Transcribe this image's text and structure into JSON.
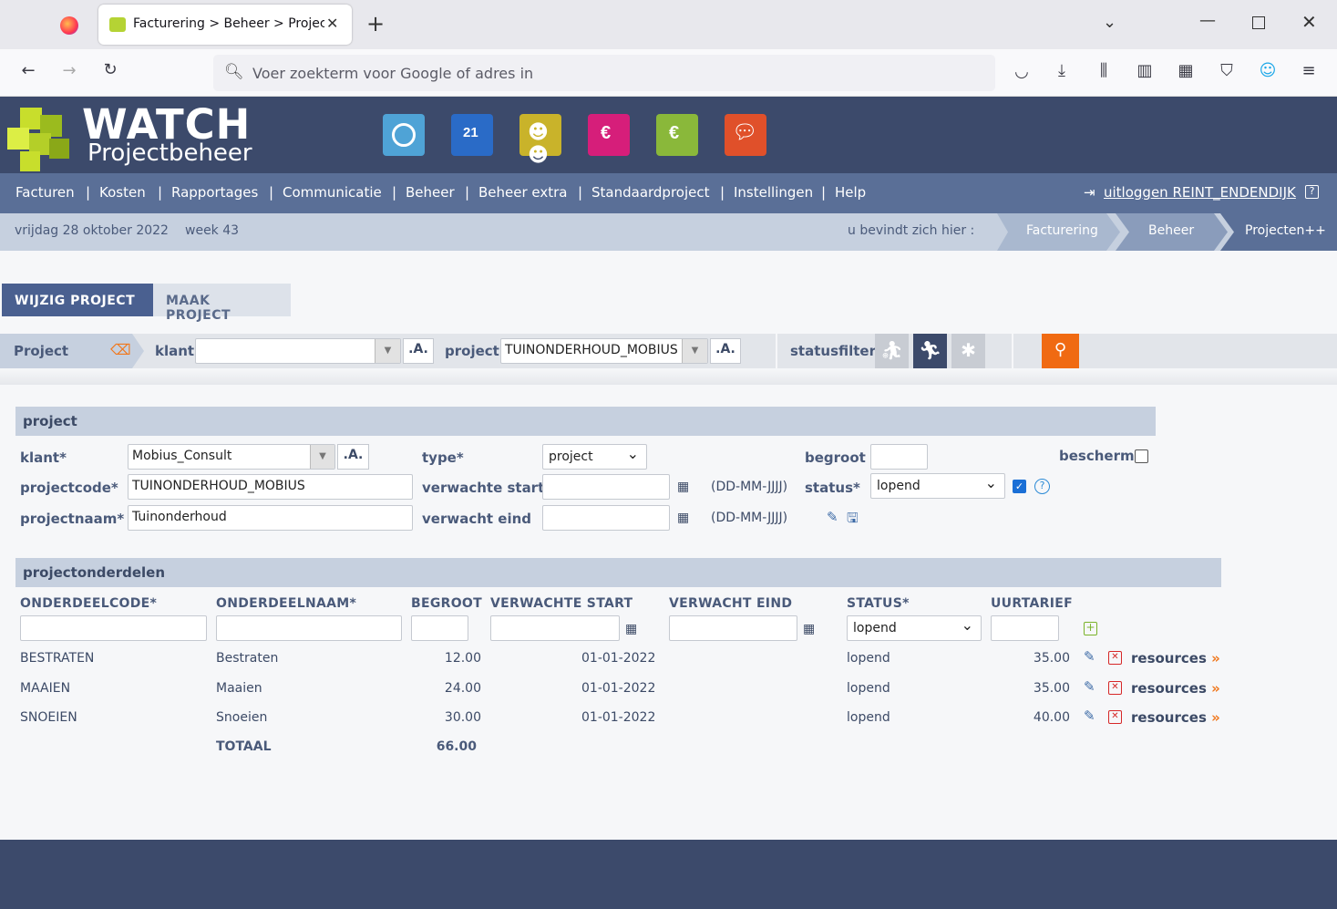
{
  "browser": {
    "tab_title": "Facturering > Beheer > Projecten++",
    "url_placeholder": "Voer zoekterm voor Google of adres in"
  },
  "header": {
    "logo_title": "WATCH",
    "logo_subtitle": "Projectbeheer",
    "apps": [
      {
        "name": "tijd",
        "color": "#4fa3d6"
      },
      {
        "name": "kalender",
        "color": "#2a6bc7"
      },
      {
        "name": "relaties",
        "color": "#c9b32a"
      },
      {
        "name": "facturen",
        "color": "#d61e7a"
      },
      {
        "name": "kosten",
        "color": "#8ab83a"
      },
      {
        "name": "communicatie",
        "color": "#e0502a"
      }
    ]
  },
  "menu": {
    "items": [
      "Facturen",
      "Kosten",
      "Rapportages",
      "Communicatie",
      "Beheer",
      "Beheer extra",
      "Standaardproject",
      "Instellingen",
      "Help"
    ],
    "logout": "uitloggen REINT_ENDENDIJK"
  },
  "crumbbar": {
    "date": "vrijdag 28 oktober 2022",
    "week": "week 43",
    "here": "u bevindt zich hier :",
    "crumbs": [
      "Facturering",
      "Beheer",
      "Projecten++"
    ]
  },
  "tabs": {
    "edit": "WIJZIG PROJECT",
    "create": "MAAK PROJECT"
  },
  "filter": {
    "section": "Project",
    "klant_label": "klant",
    "klant_value": "",
    "a_btn": ".A.",
    "project_label": "project",
    "project_value": "TUINONDERHOUD_MOBIUS",
    "status_label": "statusfilter"
  },
  "project": {
    "title": "project",
    "klant_label": "klant*",
    "klant_value": "Mobius_Consult",
    "code_label": "projectcode*",
    "code_value": "TUINONDERHOUD_MOBIUS",
    "name_label": "projectnaam*",
    "name_value": "Tuinonderhoud",
    "type_label": "type*",
    "type_value": "project",
    "start_label": "verwachte start",
    "end_label": "verwacht eind",
    "date_fmt": "(DD-MM-JJJJ)",
    "begroot_label": "begroot",
    "begroot_value": "",
    "status_label": "status*",
    "status_value": "lopend",
    "bescherm_label": "bescherm"
  },
  "parts": {
    "title": "projectonderdelen",
    "headers": [
      "ONDERDEELCODE*",
      "ONDERDEELNAAM*",
      "BEGROOT",
      "VERWACHTE START",
      "VERWACHT EIND",
      "STATUS*",
      "UURTARIEF"
    ],
    "new_status": "lopend",
    "rows": [
      {
        "code": "BESTRATEN",
        "name": "Bestraten",
        "begroot": "12.00",
        "start": "01-01-2022",
        "status": "lopend",
        "tarief": "35.00",
        "res": "resources"
      },
      {
        "code": "MAAIEN",
        "name": "Maaien",
        "begroot": "24.00",
        "start": "01-01-2022",
        "status": "lopend",
        "tarief": "35.00",
        "res": "resources"
      },
      {
        "code": "SNOEIEN",
        "name": "Snoeien",
        "begroot": "30.00",
        "start": "01-01-2022",
        "status": "lopend",
        "tarief": "40.00",
        "res": "resources"
      }
    ],
    "total_label": "TOTAAL",
    "total_value": "66.00"
  }
}
